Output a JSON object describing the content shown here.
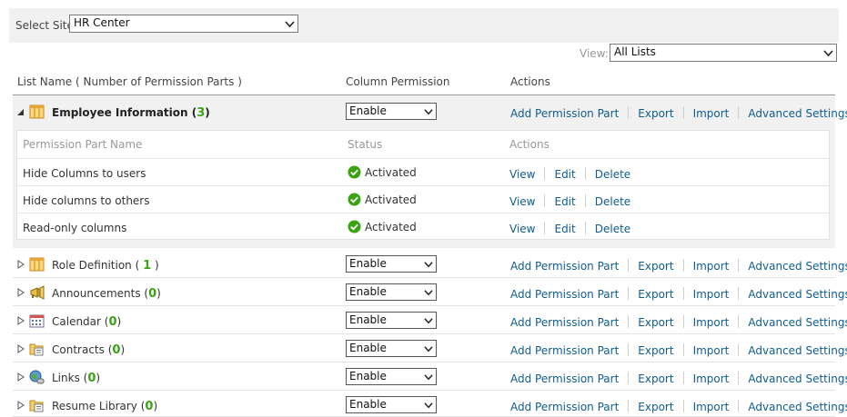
{
  "site": {
    "label": "Select Site:",
    "value": "HR Center"
  },
  "view": {
    "label": "View:",
    "value": "All Lists"
  },
  "headers": {
    "list_name": "List Name ( Number of Permission Parts )",
    "column_permission": "Column Permission",
    "actions": "Actions"
  },
  "actions": {
    "add": "Add Permission Part",
    "export": "Export",
    "import": "Import",
    "advanced": "Advanced Settings"
  },
  "expanded": {
    "name": "Employee Information",
    "count_open": "(",
    "count": "3",
    "count_close": ")",
    "permission": "Enable",
    "sub_headers": {
      "name": "Permission Part Name",
      "status": "Status",
      "actions": "Actions"
    },
    "sub_actions": {
      "view": "View",
      "edit": "Edit",
      "delete": "Delete"
    },
    "parts": [
      {
        "name": "Hide Columns to users",
        "status": "Activated"
      },
      {
        "name": "Hide columns to others",
        "status": "Activated"
      },
      {
        "name": "Read-only columns",
        "status": "Activated"
      }
    ]
  },
  "lists": [
    {
      "name": "Role Definition",
      "count": "1",
      "permission": "Enable",
      "icon": "table-icon"
    },
    {
      "name": "Announcements",
      "count": "0",
      "permission": "Enable",
      "icon": "megaphone-icon"
    },
    {
      "name": "Calendar",
      "count": "0",
      "permission": "Enable",
      "icon": "calendar-icon"
    },
    {
      "name": "Contracts",
      "count": "0",
      "permission": "Enable",
      "icon": "folder-doc-icon"
    },
    {
      "name": "Links",
      "count": "0",
      "permission": "Enable",
      "icon": "globe-link-icon"
    },
    {
      "name": "Resume Library",
      "count": "0",
      "permission": "Enable",
      "icon": "folder-doc-icon"
    }
  ],
  "colors": {
    "link": "#0f5d8f",
    "count": "#3aa311",
    "activated": "#3aa311"
  }
}
